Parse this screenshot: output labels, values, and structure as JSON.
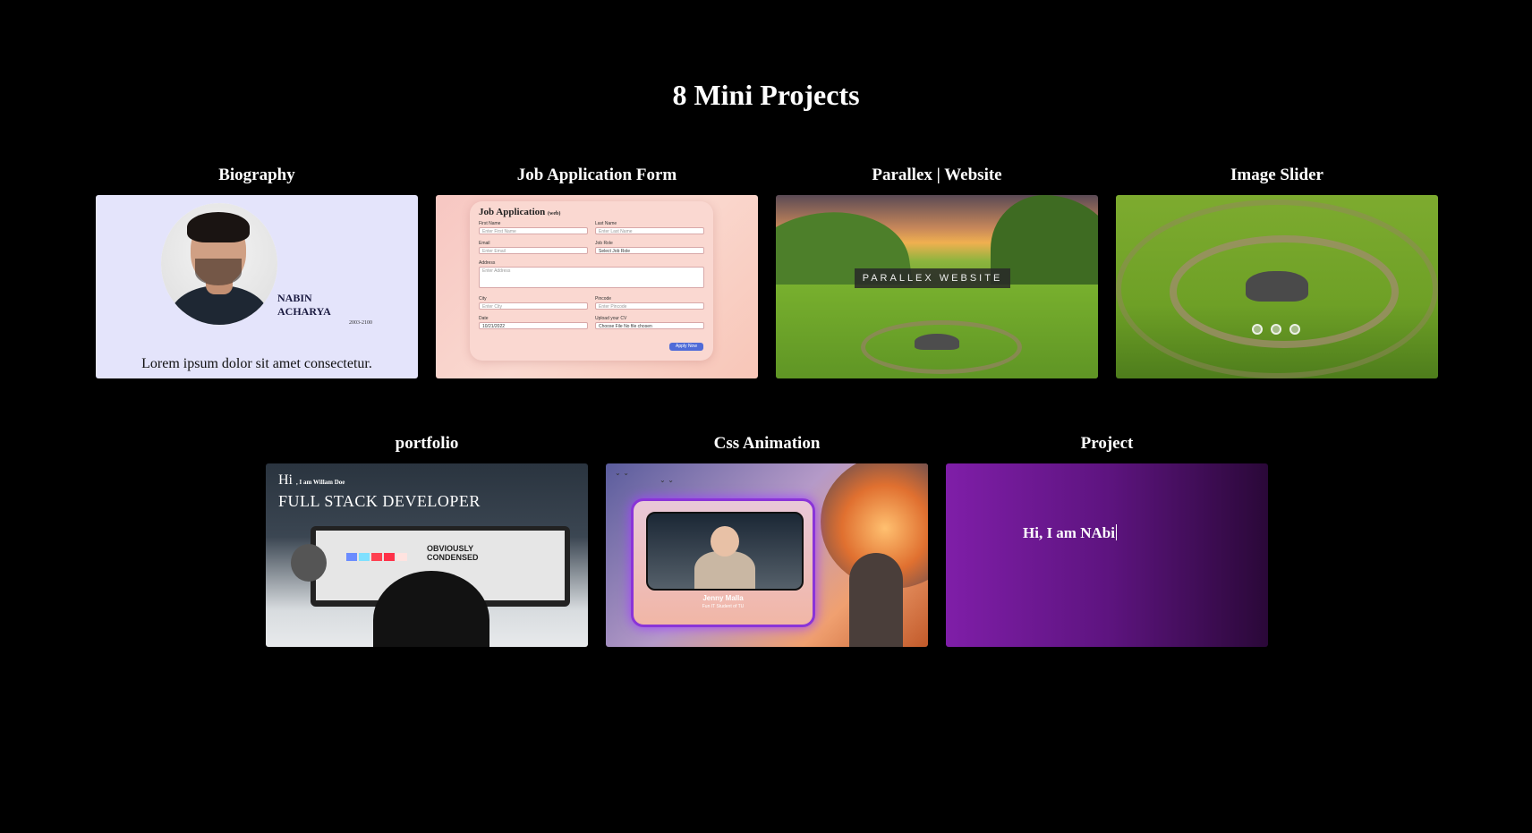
{
  "page": {
    "title": "8 Mini Projects"
  },
  "projects": [
    {
      "title": "Biography",
      "thumb": {
        "name_line1": "NABIN",
        "name_line2": "ACHARYA",
        "years": "2003-2100",
        "text": "Lorem ipsum dolor sit amet consectetur."
      }
    },
    {
      "title": "Job Application Form",
      "thumb": {
        "heading": "Job Application",
        "heading_tag": "(web)",
        "fields": [
          {
            "label": "First Name",
            "placeholder": "Enter First Name"
          },
          {
            "label": "Last Name",
            "placeholder": "Enter Last Name"
          },
          {
            "label": "Email",
            "placeholder": "Enter Email"
          },
          {
            "label": "Job Role",
            "placeholder": "Select Job Role"
          },
          {
            "label": "Address",
            "placeholder": "Enter Address"
          },
          {
            "label": "City",
            "placeholder": "Enter City"
          },
          {
            "label": "Pincode",
            "placeholder": "Enter Pincode"
          },
          {
            "label": "Date",
            "placeholder": "10/21/2022"
          },
          {
            "label": "Upload your CV",
            "placeholder": "Choose File  No file chosen"
          }
        ],
        "button": "Apply Now"
      }
    },
    {
      "title": "Parallex | Website",
      "thumb": {
        "label": "PARALLEX WEBSITE"
      }
    },
    {
      "title": "Image Slider",
      "thumb": {
        "dots": 3
      }
    },
    {
      "title": "portfolio",
      "thumb": {
        "hi": "Hi",
        "intro": ", I am Willam Doe",
        "role": "FULL STACK DEVELOPER",
        "screen_text": "OBVIOUSLY CONDENSED"
      }
    },
    {
      "title": "Css Animation",
      "thumb": {
        "name": "Jenny Malla",
        "subtitle": "Fun IT Student of TU"
      }
    },
    {
      "title": "Project",
      "thumb": {
        "text": "Hi, I am NAbi"
      }
    }
  ],
  "colors": {
    "background": "#000000",
    "title": "#ffffff",
    "project_purple": "#7f1ea8",
    "bio_bg": "#e4e4fb"
  }
}
